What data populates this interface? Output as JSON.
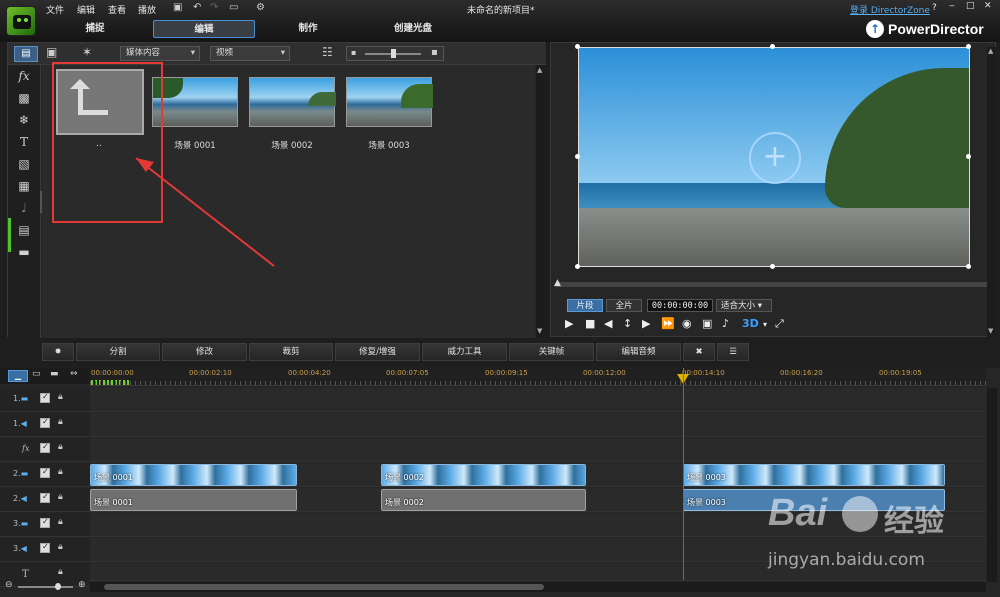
{
  "window": {
    "title": "未命名的新项目*",
    "login": "登录 DirectorZone",
    "help": "?"
  },
  "menu": [
    "文件",
    "编辑",
    "查看",
    "播放"
  ],
  "modes": [
    "捕捉",
    "编辑",
    "制作",
    "创建光盘"
  ],
  "brand": "PowerDirector",
  "library": {
    "media_filter": "媒体内容",
    "view": "视频",
    "items": [
      {
        "label": ".."
      },
      {
        "label": "场景 0001"
      },
      {
        "label": "场景 0002"
      },
      {
        "label": "场景 0003"
      }
    ]
  },
  "preview": {
    "clip_tab": "片段",
    "full_tab": "全片",
    "timecode": "00:00:00:00",
    "fit": "适合大小",
    "three_d": "3D"
  },
  "toolbar": [
    "分割",
    "修改",
    "裁剪",
    "修复/增强",
    "威力工具",
    "关键帧",
    "编辑音频"
  ],
  "ruler": [
    "00:00:00:00",
    "00:00:02:10",
    "00:00:04:20",
    "00:00:07:05",
    "00:00:09:15",
    "00:00:12:00",
    "00:00:14:10",
    "00:00:16:20",
    "00:00:19:05"
  ],
  "tracks": [
    {
      "num": "1."
    },
    {
      "num": "1."
    },
    {
      "num": "fx"
    },
    {
      "num": "2."
    },
    {
      "num": "2."
    },
    {
      "num": "3."
    },
    {
      "num": "3."
    },
    {
      "num": "T"
    }
  ],
  "clips": {
    "v1": "场景 0001",
    "v2": "场景 0002",
    "v3": "场景 0003",
    "a1": "场景 0001",
    "a2": "场景 0002",
    "a3": "场景 0003"
  },
  "watermark": {
    "brand": "Bai",
    "brand2": "经验",
    "url": "jingyan.baidu.com"
  },
  "colors": {
    "accent": "#4a8fd0",
    "playhead": "#e33333",
    "annotation": "#e53935"
  }
}
